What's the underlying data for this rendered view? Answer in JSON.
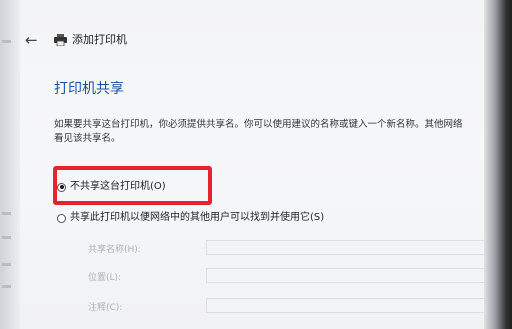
{
  "window": {
    "title": "添加打印机",
    "back_icon": "back-arrow-icon",
    "printer_icon": "printer-icon"
  },
  "section": {
    "title": "打印机共享"
  },
  "description": {
    "line1": "如果要共享这台打印机，你必须提供共享名。你可以使用建议的名称或键入一个新名称。其他网络",
    "line2": "看见该共享名。"
  },
  "options": [
    {
      "label": "不共享这台打印机(O)",
      "selected": true
    },
    {
      "label": "共享此打印机以便网络中的其他用户可以找到并使用它(S)",
      "selected": false
    }
  ],
  "fields": [
    {
      "label": "共享名称(H):",
      "value": ""
    },
    {
      "label": "位置(L):",
      "value": ""
    },
    {
      "label": "注释(C):",
      "value": ""
    }
  ],
  "colors": {
    "accent_title": "#1e4fa0",
    "highlight_box": "#e3242b"
  }
}
